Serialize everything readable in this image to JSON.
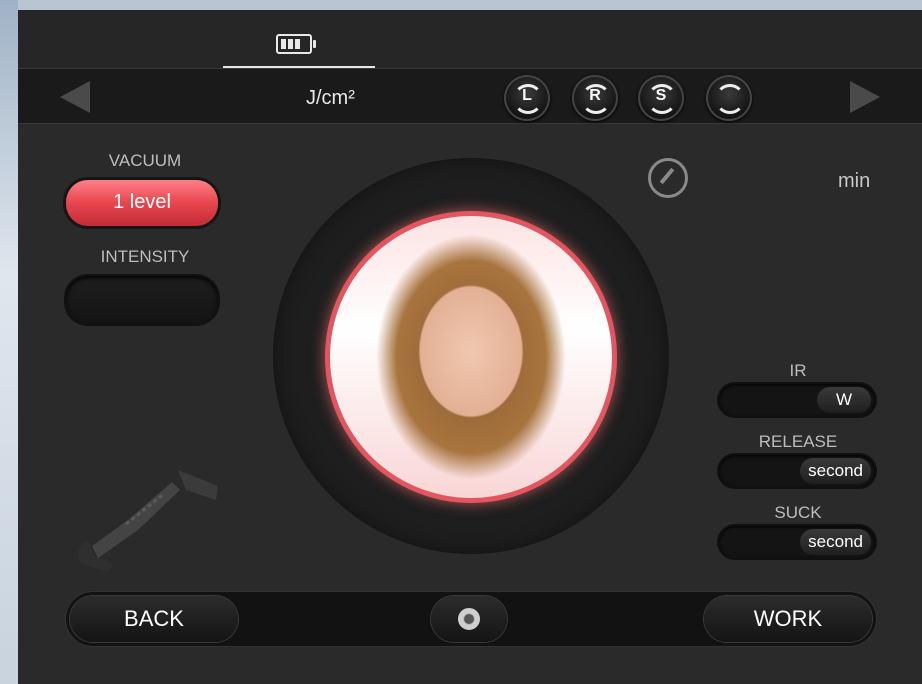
{
  "header": {
    "unit_label": "J/cm²"
  },
  "modes": [
    {
      "letter": "L"
    },
    {
      "letter": "R"
    },
    {
      "letter": "S"
    },
    {
      "letter": ""
    }
  ],
  "left": {
    "vacuum_label": "VACUUM",
    "vacuum_value": "1 level",
    "intensity_label": "INTENSITY",
    "intensity_value": ""
  },
  "timer": {
    "unit": "min"
  },
  "right": {
    "ir_label": "IR",
    "ir_unit": "W",
    "release_label": "RELEASE",
    "release_unit": "second",
    "suck_label": "SUCK",
    "suck_unit": "second"
  },
  "footer": {
    "back_label": "BACK",
    "work_label": "WORK"
  }
}
